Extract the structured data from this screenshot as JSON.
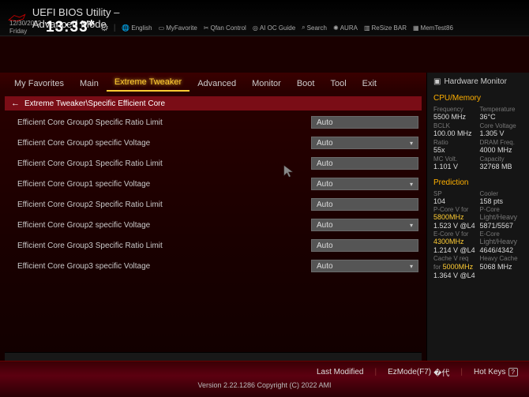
{
  "header": {
    "title": "UEFI BIOS Utility – Advanced Mode",
    "date": "12/30/2022",
    "day": "Friday",
    "time": "13:33",
    "tools": {
      "lang": "English",
      "fav": "MyFavorite",
      "qfan": "Qfan Control",
      "aioc": "AI OC Guide",
      "search": "Search",
      "aura": "AURA",
      "resize": "ReSize BAR",
      "memtest": "MemTest86"
    }
  },
  "tabs": [
    "My Favorites",
    "Main",
    "Extreme Tweaker",
    "Advanced",
    "Monitor",
    "Boot",
    "Tool",
    "Exit"
  ],
  "active_tab": "Extreme Tweaker",
  "breadcrumb": "Extreme Tweaker\\Specific Efficient Core",
  "rows": [
    {
      "label": "Efficient Core Group0 Specific Ratio Limit",
      "type": "text",
      "value": "Auto"
    },
    {
      "label": "Efficient Core Group0 specific Voltage",
      "type": "dd",
      "value": "Auto"
    },
    {
      "label": "Efficient Core Group1 Specific Ratio Limit",
      "type": "text",
      "value": "Auto"
    },
    {
      "label": "Efficient Core Group1 specific Voltage",
      "type": "dd",
      "value": "Auto"
    },
    {
      "label": "Efficient Core Group2 Specific Ratio Limit",
      "type": "text",
      "value": "Auto"
    },
    {
      "label": "Efficient Core Group2 specific Voltage",
      "type": "dd",
      "value": "Auto"
    },
    {
      "label": "Efficient Core Group3 Specific Ratio Limit",
      "type": "text",
      "value": "Auto"
    },
    {
      "label": "Efficient Core Group3 specific Voltage",
      "type": "dd",
      "value": "Auto"
    }
  ],
  "hw": {
    "title": "Hardware Monitor",
    "sec1": "CPU/Memory",
    "grid1": [
      {
        "l": "Frequency",
        "v": "5500 MHz"
      },
      {
        "l": "Temperature",
        "v": "36°C"
      },
      {
        "l": "BCLK",
        "v": "100.00 MHz"
      },
      {
        "l": "Core Voltage",
        "v": "1.305 V"
      },
      {
        "l": "Ratio",
        "v": "55x"
      },
      {
        "l": "DRAM Freq.",
        "v": "4000 MHz"
      },
      {
        "l": "MC Volt.",
        "v": "1.101 V"
      },
      {
        "l": "Capacity",
        "v": "32768 MB"
      }
    ],
    "sec2": "Prediction",
    "grid2": [
      {
        "l": "SP",
        "v": "104"
      },
      {
        "l": "Cooler",
        "v": "158 pts"
      },
      {
        "l": "P-Core V for",
        "v": "5800MHz",
        "y": 1
      },
      {
        "l": "P-Core",
        "v": "Light/Heavy",
        "dim": 1
      },
      {
        "l": "",
        "v": "1.523 V @L4"
      },
      {
        "l": "",
        "v": "5871/5567"
      },
      {
        "l": "E-Core V for",
        "v": "4300MHz",
        "y": 1
      },
      {
        "l": "E-Core",
        "v": "Light/Heavy",
        "dim": 1
      },
      {
        "l": "",
        "v": "1.214 V @L4"
      },
      {
        "l": "",
        "v": "4646/4342"
      },
      {
        "l": "Cache V req",
        "v": ""
      },
      {
        "l": "Heavy Cache",
        "v": ""
      },
      {
        "l": "for ",
        "v": "5000MHz",
        "y": 1,
        "inline": 1
      },
      {
        "l": "",
        "v": "5068 MHz"
      },
      {
        "l": "",
        "v": "1.364 V @L4"
      },
      {
        "l": "",
        "v": ""
      }
    ]
  },
  "footer": {
    "last": "Last Modified",
    "ez": "EzMode(F7)",
    "hot": "Hot Keys",
    "ver": "Version 2.22.1286 Copyright (C) 2022 AMI"
  }
}
